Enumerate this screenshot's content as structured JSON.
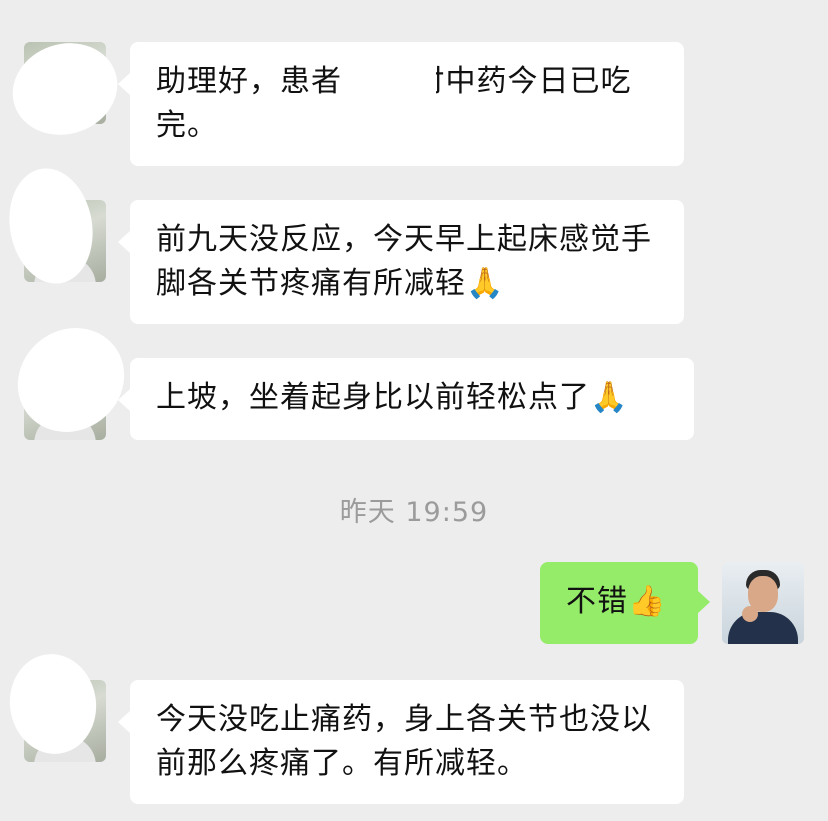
{
  "chat": {
    "timestamp": "昨天 19:59",
    "messages": [
      {
        "sender": "patient",
        "text": "助理好，患者        兰十付中药今日已吃完。"
      },
      {
        "sender": "patient",
        "text": "前九天没反应，今天早上起床感觉手脚各关节疼痛有所减轻",
        "emoji": "🙏"
      },
      {
        "sender": "patient",
        "text": "上坡，坐着起身比以前轻松点了",
        "emoji": "🙏"
      },
      {
        "sender": "doctor",
        "text": "不错",
        "emoji": "👍"
      },
      {
        "sender": "patient",
        "text": "今天没吃止痛药，身上各关节也没以前那么疼痛了。有所减轻。"
      }
    ]
  },
  "icons": {
    "thumbs_up": "thumbs-up-icon",
    "praying_hands": "praying-hands-icon"
  },
  "colors": {
    "background": "#ededed",
    "incoming_bubble": "#ffffff",
    "outgoing_bubble": "#95ec69",
    "timestamp_text": "#9b9b9b"
  }
}
